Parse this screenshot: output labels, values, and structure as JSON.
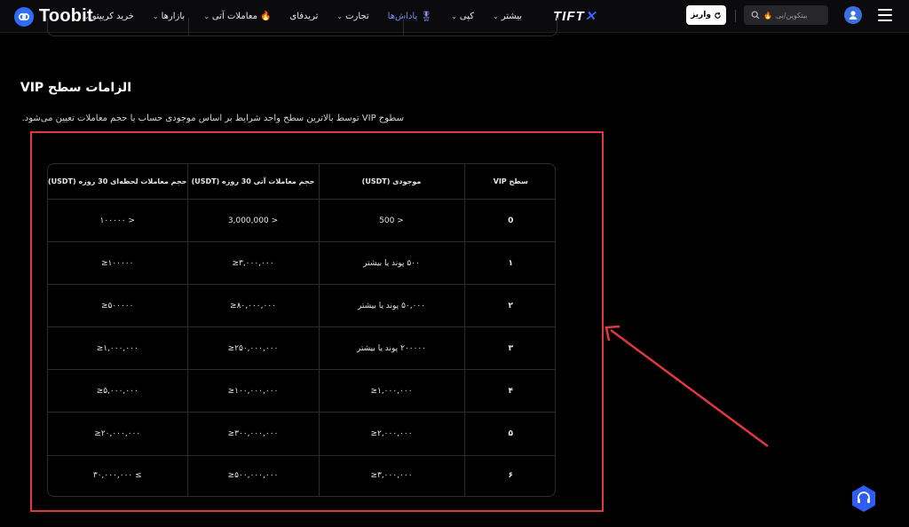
{
  "header": {
    "logo_text": "Toobit",
    "nav_items": [
      {
        "label": "خرید کریپتو",
        "has_menu": true
      },
      {
        "label": "بازارها",
        "has_menu": true
      },
      {
        "label": "معاملات آتی",
        "has_menu": true
      },
      {
        "label": "تریدفای",
        "has_menu": false
      },
      {
        "label": "تجارت",
        "has_menu": true
      },
      {
        "label": "پاداش‌ها",
        "has_menu": false
      },
      {
        "label": "کپی",
        "has_menu": true
      },
      {
        "label": "بیشتر",
        "has_menu": true
      }
    ],
    "promo_logo": "TIFT",
    "deposit_label": "واریز",
    "search_placeholder": "بیتکوین/پی",
    "accent_color": "#2f6bff"
  },
  "content": {
    "section_title": "الزامات سطح VIP",
    "description": "سطوح VIP توسط بالاترین سطح واجد شرایط بر اساس موجودی حساب یا حجم معاملات تعیین می‌شود.",
    "table": {
      "headers": [
        "حجم معاملات لحظه‌ای 30 روزه (USDT)",
        "حجم معاملات آتی 30 روزه (USDT)",
        "موجودی (USDT)",
        "سطح VIP"
      ],
      "rows": [
        [
          "< ۱۰۰۰۰۰",
          "< 3,000,000",
          "< 500",
          "0"
        ],
        [
          "۱۰۰۰۰۰≤",
          "۳,۰۰۰,۰۰۰≤",
          "۵۰۰ پوند یا بیشتر",
          "۱"
        ],
        [
          "۵۰۰۰۰۰≤",
          "۸۰,۰۰۰,۰۰۰≤",
          "۵۰,۰۰۰ پوند یا بیشتر",
          "۲"
        ],
        [
          "۱,۰۰۰,۰۰۰≤",
          "۲۵۰,۰۰۰,۰۰۰≤",
          "۲۰۰۰۰۰ پوند یا بیشتر",
          "۳"
        ],
        [
          "۵,۰۰۰,۰۰۰≤",
          "۱۰۰,۰۰۰,۰۰۰≤",
          "۱,۰۰۰,۰۰۰≤",
          "۴"
        ],
        [
          "۲۰,۰۰۰,۰۰۰≤",
          "۳۰۰,۰۰۰,۰۰۰≤",
          "۲,۰۰۰,۰۰۰≤",
          "۵"
        ],
        [
          "≥ ۳۰,۰۰۰,۰۰۰",
          "۵۰۰,۰۰۰,۰۰۰≤",
          "۳,۰۰۰,۰۰۰≤",
          "۶"
        ]
      ]
    }
  },
  "annotation": {
    "highlight_color": "#e0383d"
  }
}
